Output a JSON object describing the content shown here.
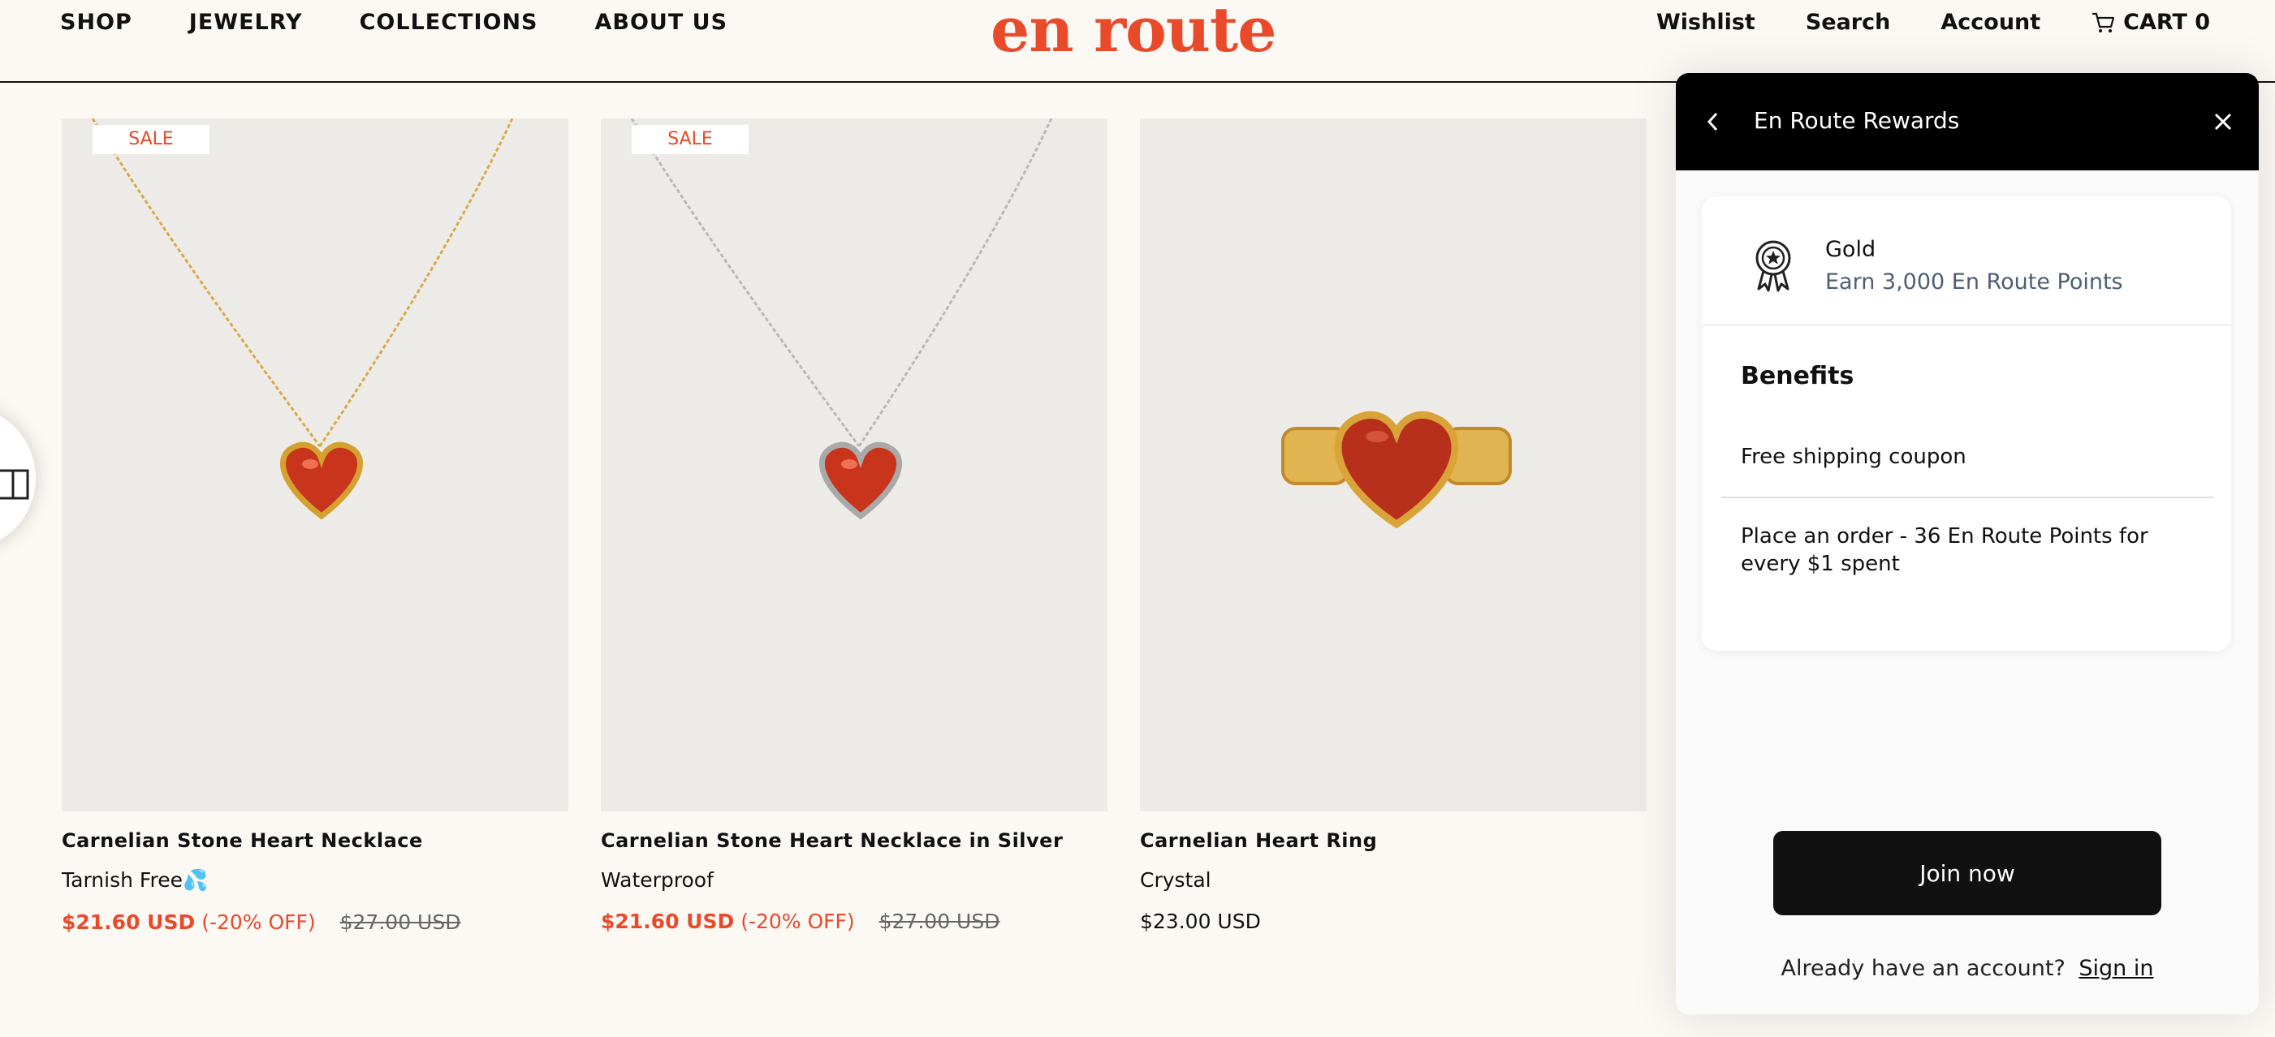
{
  "header": {
    "nav": [
      "SHOP",
      "JEWELRY",
      "COLLECTIONS",
      "ABOUT US"
    ],
    "logo": "en route",
    "wishlist": "Wishlist",
    "search": "Search",
    "account": "Account",
    "cart": "CART 0",
    "cart_icon": "cart-icon"
  },
  "products": [
    {
      "badge": "SALE",
      "name": "Carnelian Stone Heart Necklace",
      "subtitle": "Tarnish Free💦",
      "price": "$21.60 USD",
      "discount": "(-20% OFF)",
      "old_price": "$27.00 USD"
    },
    {
      "badge": "SALE",
      "name": "Carnelian Stone Heart Necklace in Silver",
      "subtitle": "Waterproof",
      "price": "$21.60 USD",
      "discount": "(-20% OFF)",
      "old_price": "$27.00 USD"
    },
    {
      "name": "Carnelian Heart Ring",
      "subtitle": "Crystal",
      "price": "$23.00 USD"
    }
  ],
  "rewards": {
    "title": "En Route Rewards",
    "tier": "Gold",
    "tier_desc": "Earn 3,000 En Route Points",
    "benefits_title": "Benefits",
    "benefits": [
      "Free shipping coupon",
      "Place an order - 36 En Route Points for every $1 spent"
    ],
    "join": "Join now",
    "signin_prompt": "Already have an account?",
    "signin_link": "Sign in"
  },
  "colors": {
    "accent": "#e84a2a",
    "background": "#fcf9f5",
    "panel_header": "#000000"
  }
}
